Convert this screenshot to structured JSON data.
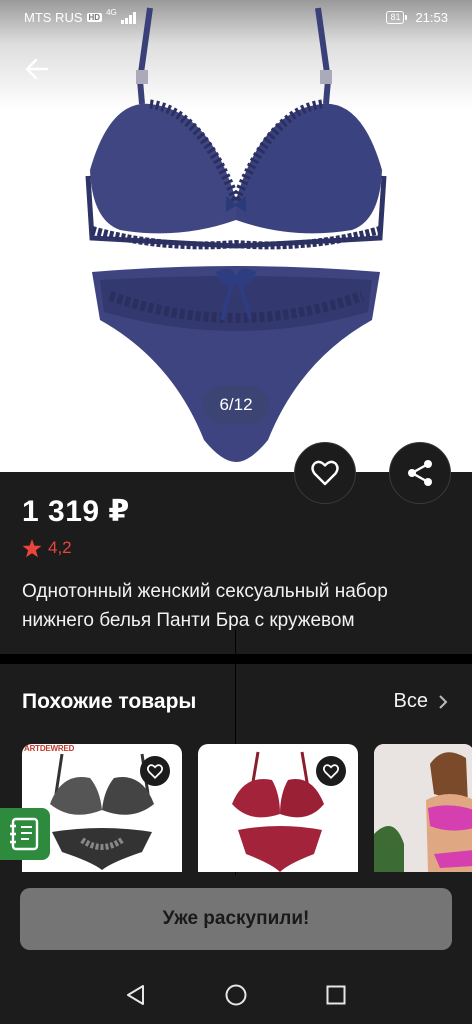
{
  "status_bar": {
    "carrier": "MTS RUS",
    "network_badge": "HD",
    "network_type": "4G",
    "battery": "81",
    "time": "21:53"
  },
  "navigation": {
    "back_icon": "arrow-left-icon"
  },
  "gallery": {
    "counter": "6/12",
    "accent_color": "#3a4078"
  },
  "actions": {
    "favorite_icon": "heart-icon",
    "share_icon": "share-icon"
  },
  "product": {
    "price": "1 319 ₽",
    "rating": "4,2",
    "rating_color": "#e8453c",
    "title": "Однотонный женский сексуальный набор нижнего белья Панти Бра с кружевом"
  },
  "similar": {
    "heading": "Похожие товары",
    "all_label": "Все",
    "items": [
      {
        "brand": "ARTDEWRED",
        "color": "#2b2b2b"
      },
      {
        "brand": "",
        "color": "#a3243a"
      },
      {
        "brand": "",
        "color": "#d63fb0"
      }
    ]
  },
  "buy_button": {
    "label": "Уже раскупили!"
  },
  "system_nav": {
    "back": "triangle-back-icon",
    "home": "circle-home-icon",
    "recents": "square-recents-icon"
  }
}
